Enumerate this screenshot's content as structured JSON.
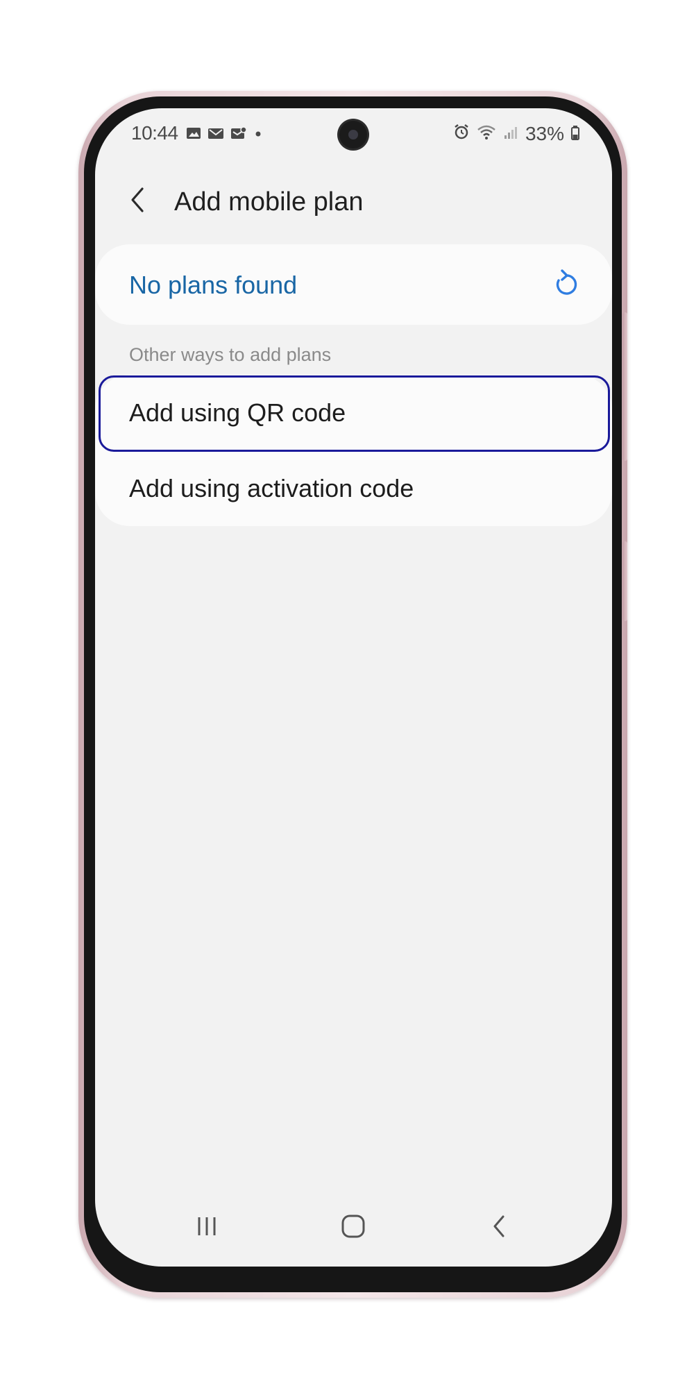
{
  "status_bar": {
    "time": "10:44",
    "battery": "33%",
    "icons": [
      "gallery-icon",
      "mail-icon",
      "message-icon",
      "dot-icon",
      "alarm-icon",
      "wifi-icon",
      "signal-icon",
      "battery-icon"
    ]
  },
  "header": {
    "title": "Add mobile plan"
  },
  "scan": {
    "status_text": "No plans found",
    "accent_color": "#1966a5"
  },
  "other_ways": {
    "section_label": "Other ways to add plans",
    "options": [
      {
        "label": "Add using QR code"
      },
      {
        "label": "Add using activation code"
      }
    ]
  },
  "colors": {
    "screen_background": "#f2f2f2",
    "card_background": "#fbfbfb",
    "highlight_border": "#1a1a9a",
    "phone_frame": "#e8d3d7"
  }
}
